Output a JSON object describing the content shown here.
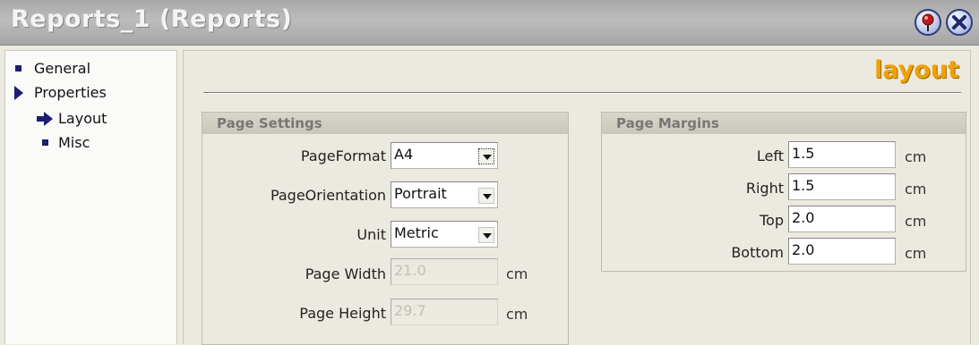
{
  "window": {
    "title": "Reports_1 (Reports)",
    "help_icon": "pin-help-icon",
    "close_icon": "close-icon"
  },
  "nav": {
    "items": [
      {
        "label": "General",
        "icon": "square-bullet-icon"
      },
      {
        "label": "Properties",
        "icon": "expanded-triangle-icon"
      },
      {
        "label": "Layout",
        "icon": "selected-arrow-icon"
      },
      {
        "label": "Misc",
        "icon": "square-bullet-icon"
      }
    ]
  },
  "main": {
    "heading": "layout",
    "page_settings": {
      "title": "Page Settings",
      "page_format": {
        "label": "PageFormat",
        "value": "A4"
      },
      "page_orientation": {
        "label": "PageOrientation",
        "value": "Portrait"
      },
      "unit": {
        "label": "Unit",
        "value": "Metric"
      },
      "page_width": {
        "label": "Page Width",
        "value": "21.0",
        "unit": "cm"
      },
      "page_height": {
        "label": "Page Height",
        "value": "29.7",
        "unit": "cm"
      }
    },
    "page_margins": {
      "title": "Page Margins",
      "left": {
        "label": "Left",
        "value": "1.5",
        "unit": "cm"
      },
      "right": {
        "label": "Right",
        "value": "1.5",
        "unit": "cm"
      },
      "top": {
        "label": "Top",
        "value": "2.0",
        "unit": "cm"
      },
      "bottom": {
        "label": "Bottom",
        "value": "2.0",
        "unit": "cm"
      }
    }
  },
  "colors": {
    "heading": "#f0a000",
    "nav_icon": "#1d1d73",
    "titlebar": "#b0b0b0"
  }
}
